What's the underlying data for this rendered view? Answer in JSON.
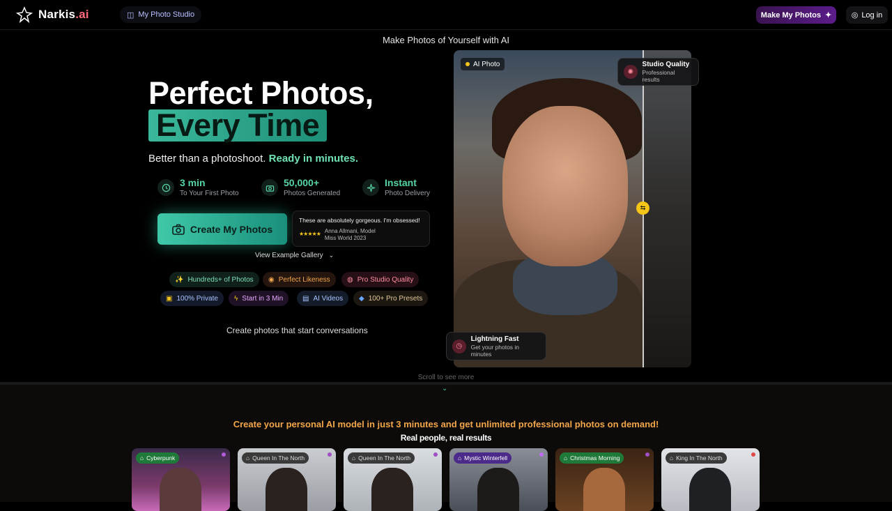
{
  "nav": {
    "brand_main": "Narkis",
    "brand_suffix": ".ai",
    "studio_link": "My Photo Studio",
    "make_button": "Make My Photos",
    "login_button": "Log in"
  },
  "hero": {
    "tagline": "Make Photos of Yourself with AI",
    "title_line1": "Perfect Photos,",
    "title_line2": "Every Time",
    "subtitle_plain": "Better than a photoshoot.",
    "subtitle_highlight": "Ready in minutes.",
    "stats": [
      {
        "value": "3 min",
        "label": "To Your First Photo",
        "icon": "clock-icon"
      },
      {
        "value": "50,000+",
        "label": "Photos Generated",
        "icon": "camera-icon"
      },
      {
        "value": "Instant",
        "label": "Photo Delivery",
        "icon": "sparkle-icon"
      }
    ],
    "cta_label": "Create My Photos",
    "testimonial": {
      "quote": "These are absolutely gorgeous. I'm obsessed!",
      "stars": "★★★★★",
      "name": "Anna Allmani, Model",
      "title": "Miss World 2023"
    },
    "gallery_link": "View Example Gallery",
    "features": [
      {
        "label": "Hundreds+ of Photos",
        "icon": "sparkle-icon"
      },
      {
        "label": "Perfect Likeness",
        "icon": "target-icon"
      },
      {
        "label": "Pro Studio Quality",
        "icon": "palette-icon"
      },
      {
        "label": "100% Private",
        "icon": "lock-icon"
      },
      {
        "label": "Start in 3 Min",
        "icon": "bolt-icon"
      },
      {
        "label": "AI Videos",
        "icon": "film-icon"
      },
      {
        "label": "100+ Pro Presets",
        "icon": "presets-icon"
      }
    ],
    "conversations": "Create photos that start conversations"
  },
  "preview": {
    "ai_tag": "AI Photo",
    "studio_badge_title": "Studio Quality",
    "studio_badge_sub": "Professional results",
    "fast_badge_title": "Lightning Fast",
    "fast_badge_sub": "Get your photos in minutes"
  },
  "scroll_hint": "Scroll to see more",
  "promo": {
    "headline": "Create your personal AI model in just 3 minutes and get unlimited professional photos on demand!",
    "sub": "Real people, real results"
  },
  "styles": [
    {
      "label": "Cyberpunk",
      "tag_color": "#1f7a3a",
      "dot": "#b05cd6"
    },
    {
      "label": "Queen In The North",
      "tag_color": "#3a3a3a",
      "dot": "#a04fc4"
    },
    {
      "label": "Queen In The North",
      "tag_color": "#3a3a3a",
      "dot": "#a04fc4"
    },
    {
      "label": "Mystic Winterfell",
      "tag_color": "#4b2a8a",
      "dot": "#c06cf0"
    },
    {
      "label": "Christmas Morning",
      "tag_color": "#1f7a3a",
      "dot": "#a04fc4"
    },
    {
      "label": "King In The North",
      "tag_color": "#3a3a3a",
      "dot": "#e04848"
    }
  ],
  "colors": {
    "accent": "#3fc8a8",
    "brand": "#ff6b7d",
    "promo": "#f3a64a"
  }
}
